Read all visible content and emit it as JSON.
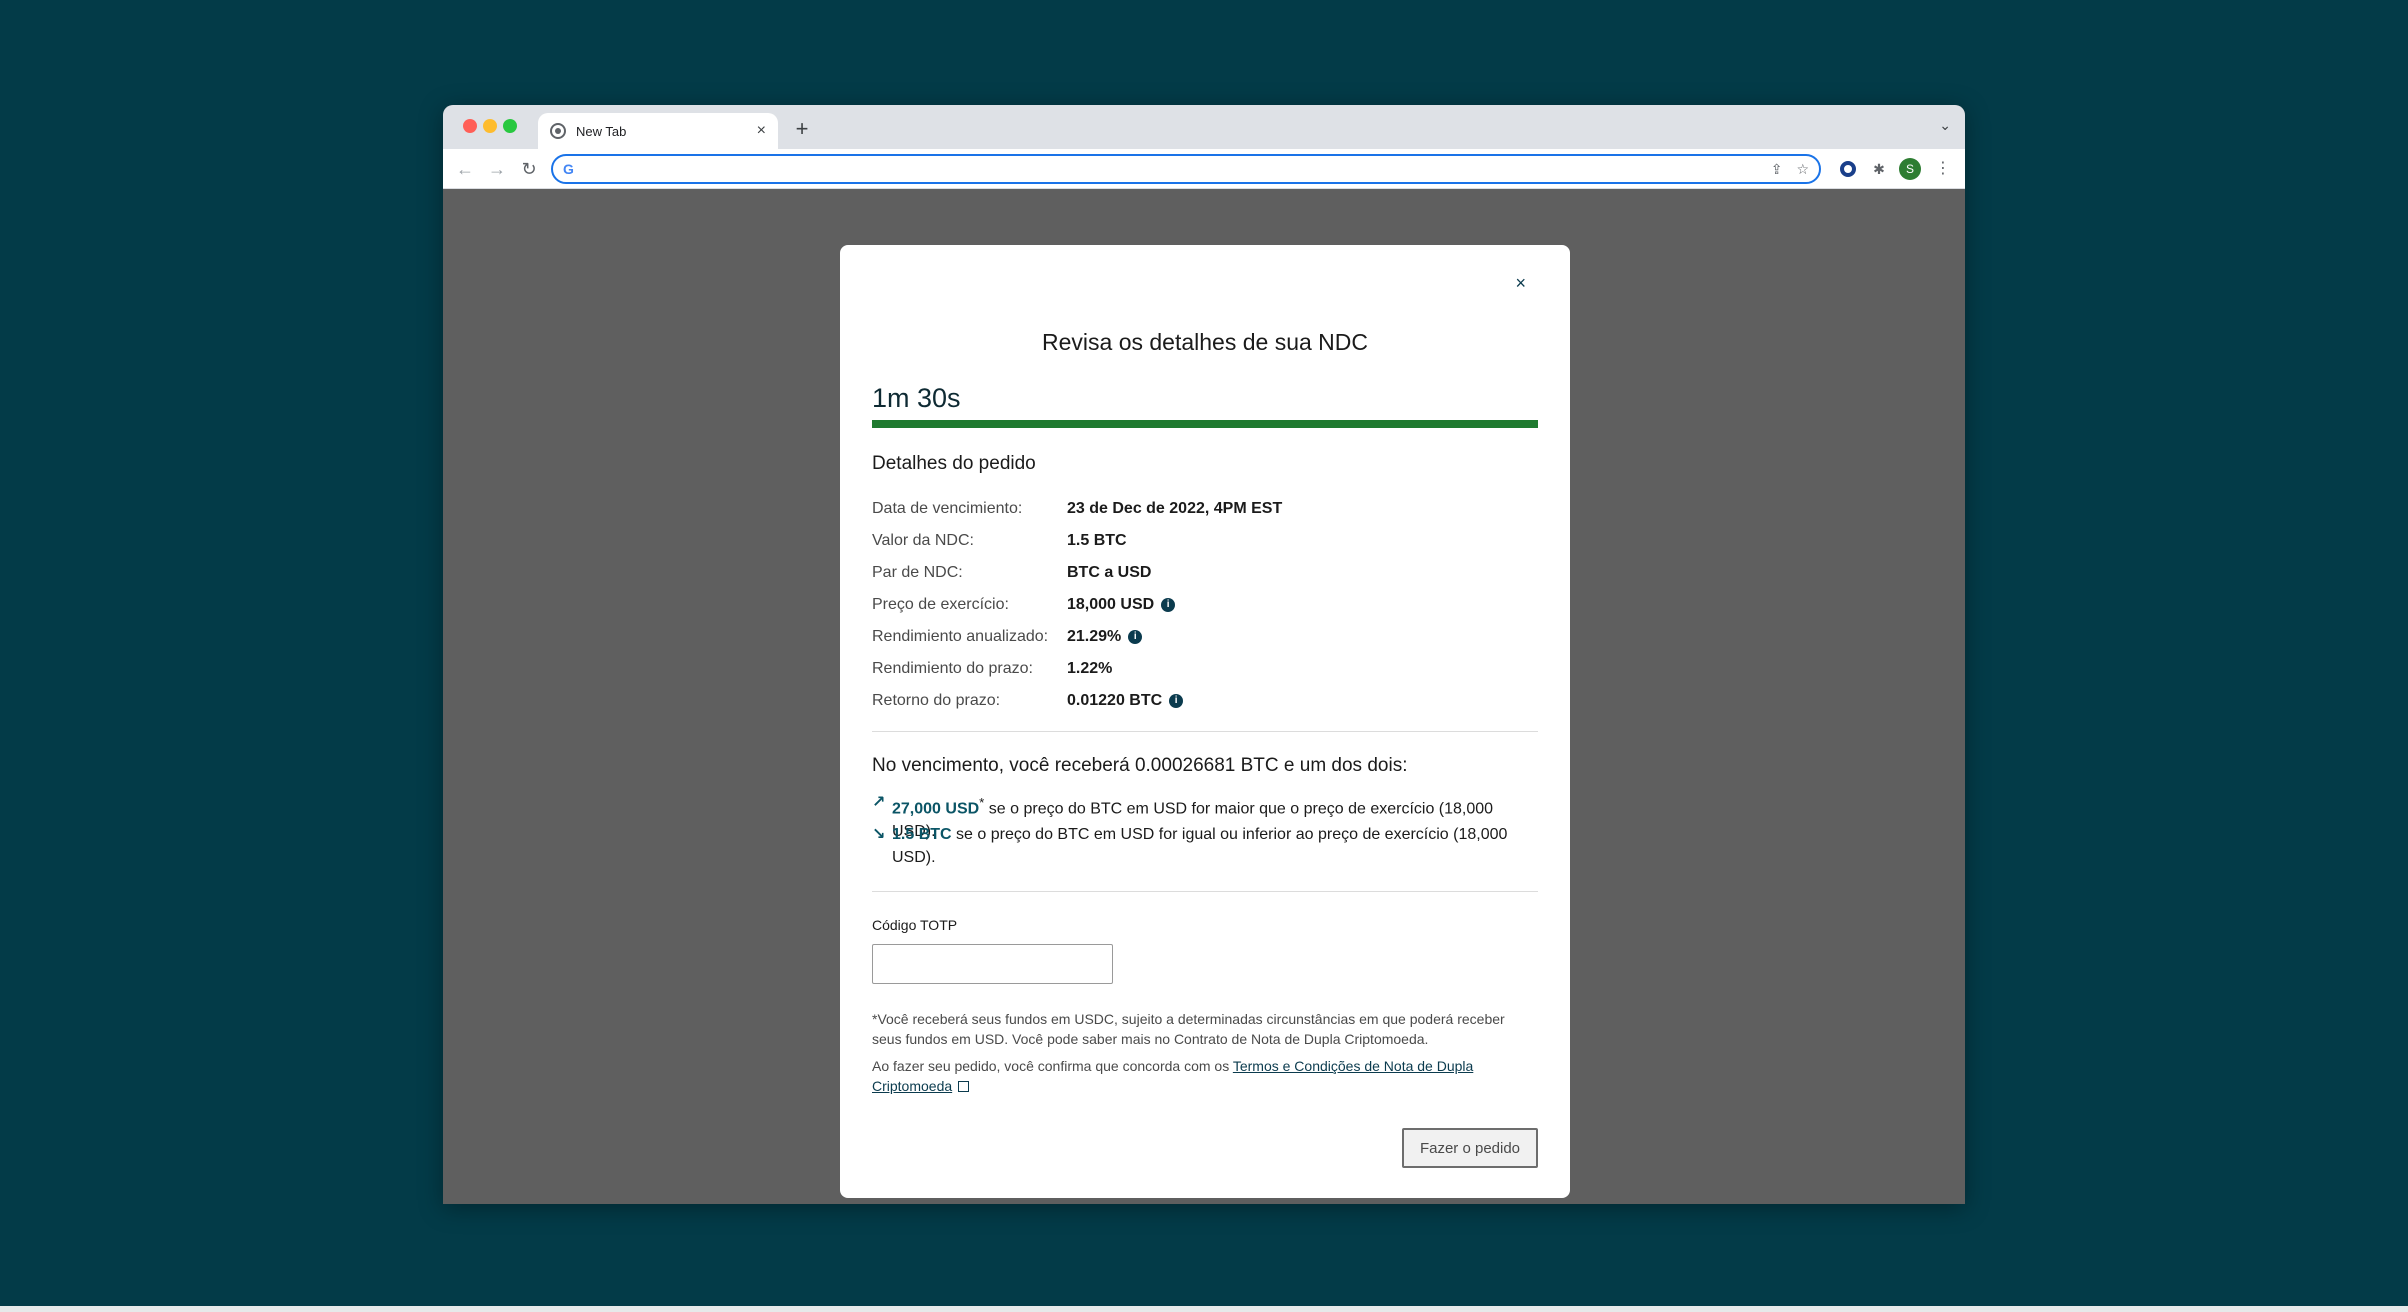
{
  "browser": {
    "tab_title": "New Tab",
    "tab_close": "×",
    "new_tab": "+",
    "avatar_letter": "S",
    "omnibox_value": ""
  },
  "modal": {
    "close": "×",
    "title": "Revisa os detalhes de sua NDC",
    "timer": "1m 30s",
    "progress_fraction": 1.0,
    "progress_color": "#1f7a2f",
    "order_details_title": "Detalhes do pedido",
    "details": [
      {
        "label": "Data de vencimiento:",
        "value": "23 de Dec de 2022, 4PM EST",
        "info": false
      },
      {
        "label": "Valor da NDC:",
        "value": "1.5 BTC",
        "info": false
      },
      {
        "label": "Par de NDC:",
        "value": "BTC a USD",
        "info": false
      },
      {
        "label": "Preço de exercício:",
        "value": "18,000 USD",
        "info": true
      },
      {
        "label": "Rendimiento anualizado:",
        "value": "21.29%",
        "info": true
      },
      {
        "label": "Rendimiento do prazo:",
        "value": "1.22%",
        "info": false
      },
      {
        "label": "Retorno do prazo:",
        "value": "0.01220 BTC",
        "info": true
      }
    ],
    "maturity_title": "No vencimento, você receberá 0.00026681 BTC e um dos dois:",
    "outcome_up": {
      "arrow": "↗",
      "highlight": "27,000 USD",
      "asterisk": "*",
      "text": " se o preço do BTC em USD for maior que o preço de exercício (18,000 USD)."
    },
    "outcome_down": {
      "arrow": "↘",
      "highlight": "1.5 BTC",
      "text": " se o preço do BTC em USD for igual ou inferior ao preço de exercício (18,000 USD)."
    },
    "totp_label": "Código TOTP",
    "totp_value": "",
    "fine_print": "*Você receberá seus fundos em USDC, sujeito a determinadas circunstâncias em que poderá receber seus fundos em USD. Você pode saber mais no Contrato de Nota de Dupla Criptomoeda.",
    "terms_prefix": "Ao fazer seu pedido, você confirma que concorda com os ",
    "terms_link": "Termos e Condições de Nota de Dupla Criptomoeda",
    "submit_label": "Fazer o pedido"
  }
}
